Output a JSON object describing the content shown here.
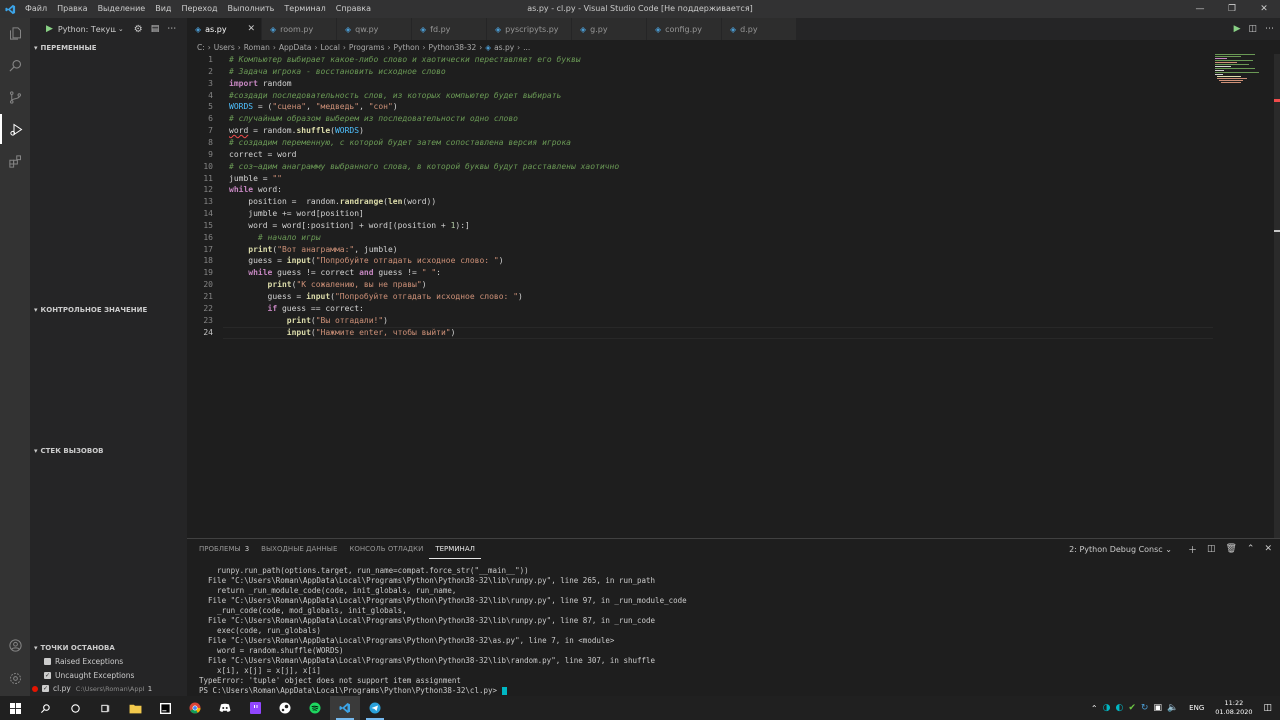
{
  "window": {
    "title": "as.py - cl.py - Visual Studio Code [Не поддерживается]",
    "menu": [
      "Файл",
      "Правка",
      "Выделение",
      "Вид",
      "Переход",
      "Выполнить",
      "Терминал",
      "Справка"
    ]
  },
  "debug": {
    "config_label": "Python: Текущ"
  },
  "sidebar": {
    "sections": {
      "variables": "ПЕРЕМЕННЫЕ",
      "watch": "КОНТРОЛЬНОЕ ЗНАЧЕНИЕ",
      "callstack": "СТЕК ВЫЗОВОВ",
      "breakpoints": "ТОЧКИ ОСТАНОВА"
    },
    "breakpoints": [
      {
        "label": "Raised Exceptions",
        "checked": false
      },
      {
        "label": "Uncaught Exceptions",
        "checked": true
      },
      {
        "label": "cl.py",
        "path": "C:\\Users\\Roman\\AppData\\...",
        "count": "1",
        "checked": true
      }
    ]
  },
  "tabs": [
    {
      "label": "as.py",
      "active": true
    },
    {
      "label": "room.py"
    },
    {
      "label": "qw.py"
    },
    {
      "label": "fd.py"
    },
    {
      "label": "pyscripyts.py"
    },
    {
      "label": "g.py"
    },
    {
      "label": "config.py"
    },
    {
      "label": "d.py"
    }
  ],
  "breadcrumb": [
    "C:",
    "Users",
    "Roman",
    "AppData",
    "Local",
    "Programs",
    "Python",
    "Python38-32",
    "as.py",
    "..."
  ],
  "editor": {
    "lines": [
      "# Компьютер выбирает какое-либо слово и хаотически переставляет его буквы",
      "# Задача игрока - восстановить исходное слово",
      "import random",
      "#создади последовательность слов, из которых компьютер будет выбирать",
      "WORDS = (\"сцена\", \"медведь\", \"сон\")",
      "# случайным образом выберем из последовательности одно слово",
      "word = random.shuffle(WORDS)",
      "# создадим переменную, с которой будет затем сопоставлена версия игрока",
      "correct = word",
      "# соз~адим анаграмму выбранного слова, в которой буквы будут расставлены хаотично",
      "jumble = \"\"",
      "while word:",
      "    position =  random.randrange(len(word))",
      "    jumble += word[position]",
      "    word = word[:position] + word[(position + 1):]",
      "      # начало игры",
      "    print(\"Вот анаграмма:\", jumble)",
      "    guess = input(\"Попробуйте отгадать исходное слово: \")",
      "    while guess != correct and guess != \" \":",
      "        print(\"К сожалению, вы не правы\")",
      "        guess = input(\"Попробуйте отгадать исходное слово: \")",
      "        if guess == correct:",
      "            print(\"Вы отгадали!\")",
      "            input(\"Нажмите enter, чтобы выйти\")"
    ]
  },
  "panel": {
    "tabs": [
      {
        "label": "ПРОБЛЕМЫ",
        "badge": "3"
      },
      {
        "label": "ВЫХОДНЫЕ ДАННЫЕ"
      },
      {
        "label": "КОНСОЛЬ ОТЛАДКИ"
      },
      {
        "label": "ТЕРМИНАЛ",
        "active": true
      }
    ],
    "terminal_select": "2: Python Debug Consc",
    "terminal_lines": [
      "    runpy.run_path(options.target, run_name=compat.force_str(\"__main__\"))",
      "  File \"C:\\Users\\Roman\\AppData\\Local\\Programs\\Python\\Python38-32\\lib\\runpy.py\", line 265, in run_path",
      "    return _run_module_code(code, init_globals, run_name,",
      "  File \"C:\\Users\\Roman\\AppData\\Local\\Programs\\Python\\Python38-32\\lib\\runpy.py\", line 97, in _run_module_code",
      "    _run_code(code, mod_globals, init_globals,",
      "  File \"C:\\Users\\Roman\\AppData\\Local\\Programs\\Python\\Python38-32\\lib\\runpy.py\", line 87, in _run_code",
      "    exec(code, run_globals)",
      "  File \"C:\\Users\\Roman\\AppData\\Local\\Programs\\Python\\Python38-32\\as.py\", line 7, in <module>",
      "    word = random.shuffle(WORDS)",
      "  File \"C:\\Users\\Roman\\AppData\\Local\\Programs\\Python\\Python38-32\\lib\\random.py\", line 307, in shuffle",
      "    x[i], x[j] = x[j], x[i]",
      "TypeError: 'tuple' object does not support item assignment",
      "PS C:\\Users\\Roman\\AppData\\Local\\Programs\\Python\\Python38-32\\cl.py> "
    ]
  },
  "taskbar": {
    "lang": "ENG",
    "time": "11:22",
    "date": "01.08.2020"
  },
  "colors": {
    "accent": "#007acc",
    "breakpoint": "#e51400"
  }
}
